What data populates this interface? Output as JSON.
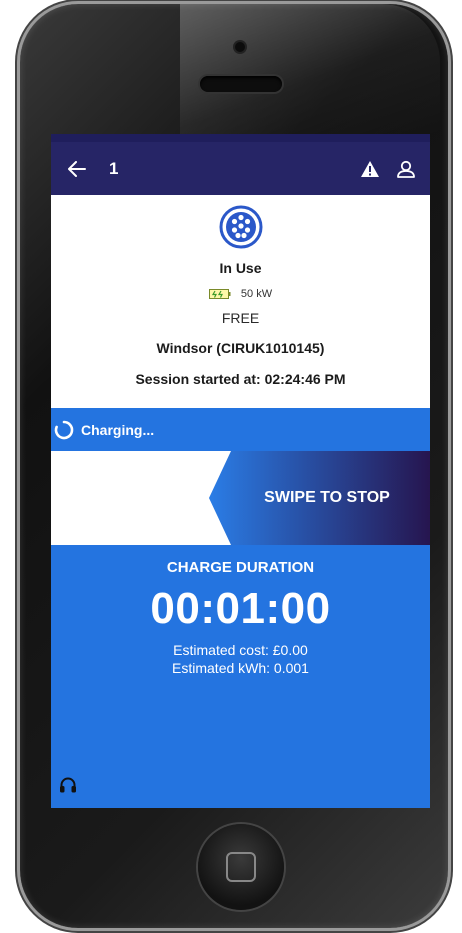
{
  "app_bar": {
    "title": "1",
    "back_icon": "arrow-left-icon",
    "warning_icon": "warning-icon",
    "profile_icon": "user-icon"
  },
  "charger": {
    "connector_icon": "ev-connector-icon",
    "status": "In Use",
    "power": "50 kW",
    "price": "FREE",
    "station": "Windsor (CIRUK1010145)",
    "session_started": "Session started at: 02:24:46 PM"
  },
  "charging": {
    "label": "Charging...",
    "spinner_icon": "loading-spinner-icon"
  },
  "swipe": {
    "label": "SWIPE TO STOP"
  },
  "duration": {
    "title": "CHARGE DURATION",
    "value": "00:01:00",
    "estimated_cost": "Estimated cost: £0.00",
    "estimated_kwh": "Estimated kWh: 0.001"
  },
  "support": {
    "icon": "headset-icon"
  },
  "colors": {
    "app_bar": "#262566",
    "accent_blue": "#2474e0",
    "swipe_gradient_start": "#2a7de6",
    "swipe_gradient_end": "#26154f"
  }
}
